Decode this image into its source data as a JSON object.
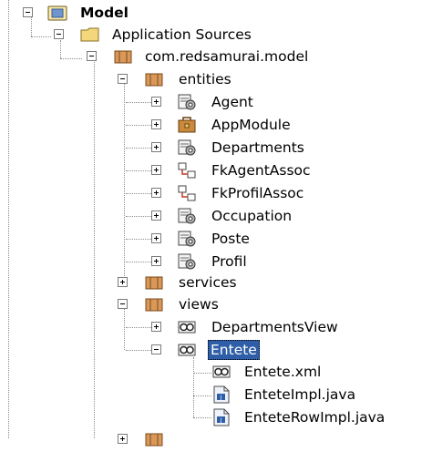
{
  "tree": {
    "root": {
      "label": "Model",
      "icon": "project-icon",
      "expanded": true
    },
    "nodes": [
      {
        "label": "Application Sources",
        "icon": "folder-icon",
        "expanded": true
      },
      {
        "label": "com.redsamurai.model",
        "icon": "package-icon",
        "expanded": true
      },
      {
        "label": "entities",
        "icon": "package-icon",
        "expanded": true
      },
      {
        "label": "Agent",
        "icon": "entity-object-icon",
        "expanded": false
      },
      {
        "label": "AppModule",
        "icon": "application-module-icon",
        "expanded": false
      },
      {
        "label": "Departments",
        "icon": "entity-object-icon",
        "expanded": false
      },
      {
        "label": "FkAgentAssoc",
        "icon": "association-icon",
        "expanded": false
      },
      {
        "label": "FkProfilAssoc",
        "icon": "association-icon",
        "expanded": false
      },
      {
        "label": "Occupation",
        "icon": "entity-object-icon",
        "expanded": false
      },
      {
        "label": "Poste",
        "icon": "entity-object-icon",
        "expanded": false
      },
      {
        "label": "Profil",
        "icon": "entity-object-icon",
        "expanded": false
      },
      {
        "label": "services",
        "icon": "package-icon",
        "expanded": false
      },
      {
        "label": "views",
        "icon": "package-icon",
        "expanded": true
      },
      {
        "label": "DepartmentsView",
        "icon": "view-object-icon",
        "expanded": false
      },
      {
        "label": "Entete",
        "icon": "view-object-icon",
        "expanded": true,
        "selected": true
      },
      {
        "label": "Entete.xml",
        "icon": "xml-file-icon"
      },
      {
        "label": "EnteteImpl.java",
        "icon": "java-file-icon"
      },
      {
        "label": "EnteteRowImpl.java",
        "icon": "java-file-icon"
      },
      {
        "label": "",
        "icon": "package-icon",
        "expanded": false
      }
    ]
  },
  "colors": {
    "selection": "#2f5ea8",
    "folder": "#f3d77a",
    "package": "#c98a3c",
    "tree_lines": "#8c8c8c"
  }
}
